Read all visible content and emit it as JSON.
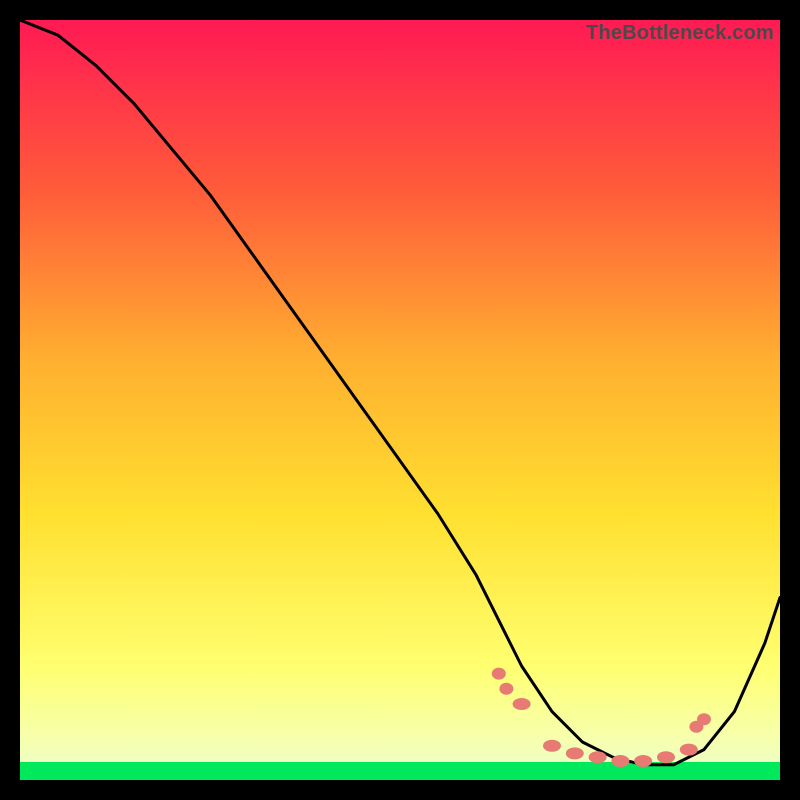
{
  "watermark": "TheBottleneck.com",
  "chart_data": {
    "type": "line",
    "title": "",
    "xlabel": "",
    "ylabel": "",
    "xlim": [
      0,
      100
    ],
    "ylim": [
      0,
      100
    ],
    "background_gradient": {
      "top": "#ff1a54",
      "mid_upper": "#ff8a2a",
      "mid": "#ffe030",
      "mid_lower": "#ffff60",
      "bottom_band": "#00ff66",
      "outer": "#000000"
    },
    "series": [
      {
        "name": "bottleneck-curve",
        "color": "#000000",
        "x": [
          0,
          5,
          10,
          15,
          20,
          25,
          30,
          35,
          40,
          45,
          50,
          55,
          60,
          63,
          66,
          70,
          74,
          78,
          82,
          86,
          90,
          94,
          98,
          100
        ],
        "y": [
          100,
          98,
          94,
          89,
          83,
          77,
          70,
          63,
          56,
          49,
          42,
          35,
          27,
          21,
          15,
          9,
          5,
          3,
          2,
          2,
          4,
          9,
          18,
          24
        ]
      }
    ],
    "markers": {
      "name": "highlight-dots",
      "color": "#e77b74",
      "points": [
        {
          "x": 63,
          "y": 14
        },
        {
          "x": 64,
          "y": 12
        },
        {
          "x": 66,
          "y": 10
        },
        {
          "x": 70,
          "y": 4.5
        },
        {
          "x": 73,
          "y": 3.5
        },
        {
          "x": 76,
          "y": 3
        },
        {
          "x": 79,
          "y": 2.5
        },
        {
          "x": 82,
          "y": 2.5
        },
        {
          "x": 85,
          "y": 3
        },
        {
          "x": 88,
          "y": 4
        },
        {
          "x": 89,
          "y": 7
        },
        {
          "x": 90,
          "y": 8
        }
      ]
    }
  }
}
